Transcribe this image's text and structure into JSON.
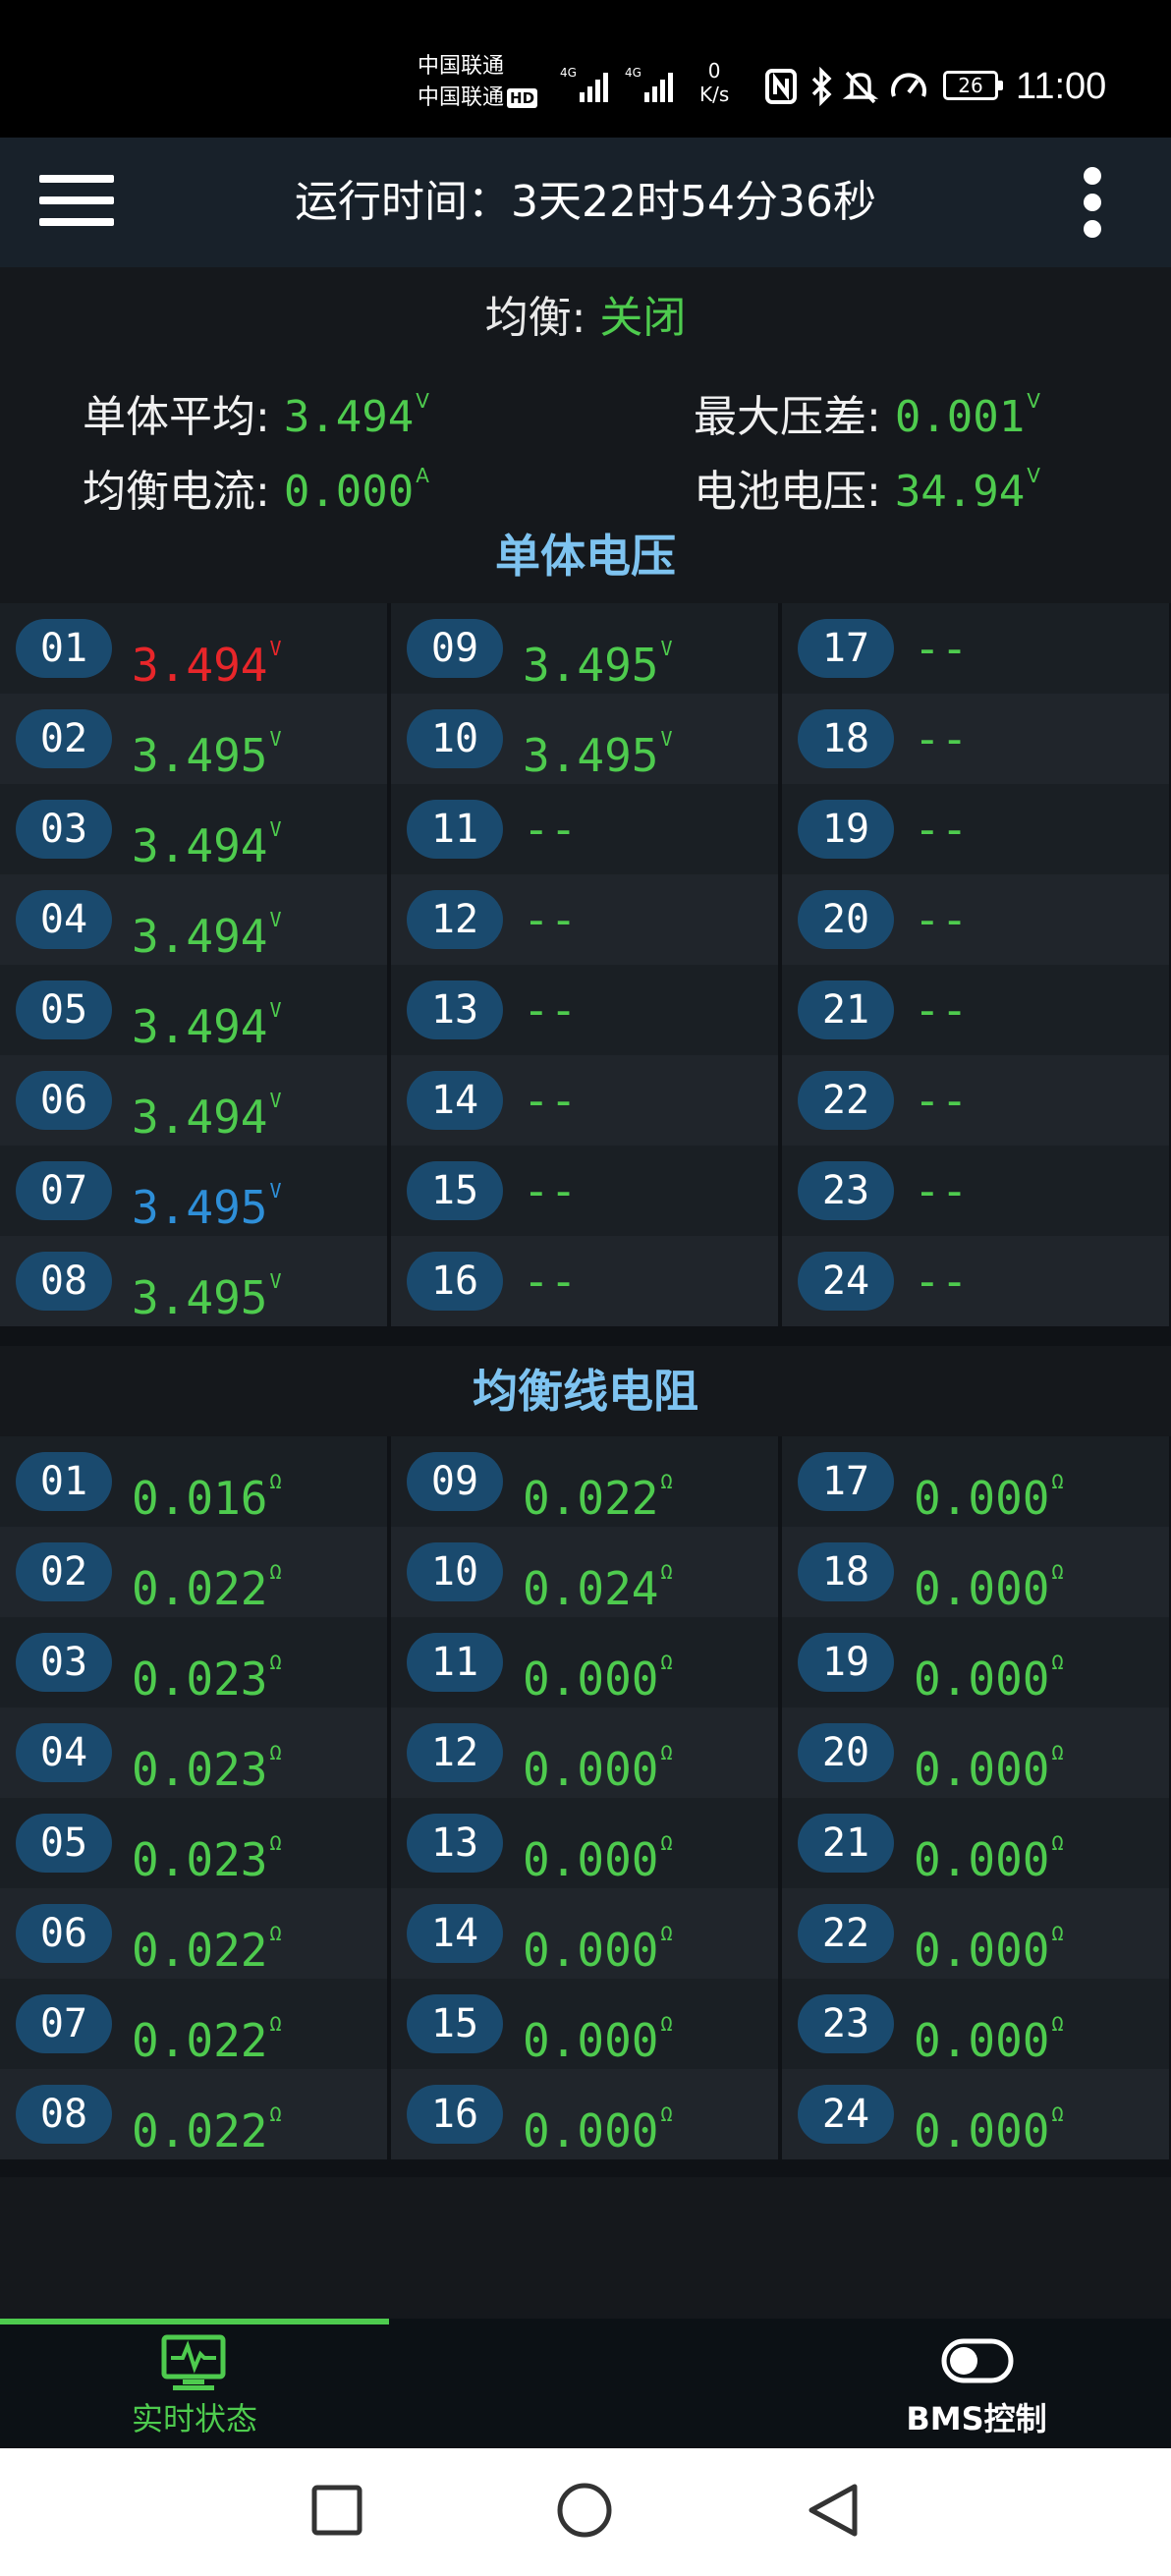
{
  "status_bar": {
    "carrier1": "中国联通",
    "carrier2": "中国联通",
    "hd_badge": "HD",
    "net1": "4G",
    "net2": "4G",
    "speed_value": "0",
    "speed_unit": "K/s",
    "battery": "26",
    "time": "11:00"
  },
  "header": {
    "title": "运行时间：3天22时54分36秒"
  },
  "summary": {
    "balance_label": "均衡: ",
    "balance_value": "关闭",
    "cell_avg_label": "单体平均: ",
    "cell_avg_value": "3.494",
    "cell_avg_unit": "V",
    "max_diff_label": "最大压差: ",
    "max_diff_value": "0.001",
    "max_diff_unit": "V",
    "balance_current_label": "均衡电流: ",
    "balance_current_value": "0.000",
    "balance_current_unit": "A",
    "battery_voltage_label": "电池电压: ",
    "battery_voltage_value": "34.94",
    "battery_voltage_unit": "V"
  },
  "cell_voltage": {
    "title": "单体电压",
    "unit": "V",
    "cells": [
      {
        "id": "01",
        "value": "3.494",
        "color": "#e8262a"
      },
      {
        "id": "02",
        "value": "3.495",
        "color": "#4ecb4e"
      },
      {
        "id": "03",
        "value": "3.494",
        "color": "#4ecb4e"
      },
      {
        "id": "04",
        "value": "3.494",
        "color": "#4ecb4e"
      },
      {
        "id": "05",
        "value": "3.494",
        "color": "#4ecb4e"
      },
      {
        "id": "06",
        "value": "3.494",
        "color": "#4ecb4e"
      },
      {
        "id": "07",
        "value": "3.495",
        "color": "#2e8fd8"
      },
      {
        "id": "08",
        "value": "3.495",
        "color": "#4ecb4e"
      },
      {
        "id": "09",
        "value": "3.495",
        "color": "#4ecb4e"
      },
      {
        "id": "10",
        "value": "3.495",
        "color": "#4ecb4e"
      },
      {
        "id": "11",
        "value": "--"
      },
      {
        "id": "12",
        "value": "--"
      },
      {
        "id": "13",
        "value": "--"
      },
      {
        "id": "14",
        "value": "--"
      },
      {
        "id": "15",
        "value": "--"
      },
      {
        "id": "16",
        "value": "--"
      },
      {
        "id": "17",
        "value": "--"
      },
      {
        "id": "18",
        "value": "--"
      },
      {
        "id": "19",
        "value": "--"
      },
      {
        "id": "20",
        "value": "--"
      },
      {
        "id": "21",
        "value": "--"
      },
      {
        "id": "22",
        "value": "--"
      },
      {
        "id": "23",
        "value": "--"
      },
      {
        "id": "24",
        "value": "--"
      }
    ]
  },
  "wire_resistance": {
    "title": "均衡线电阻",
    "unit": "Ω",
    "cells": [
      {
        "id": "01",
        "value": "0.016"
      },
      {
        "id": "02",
        "value": "0.022"
      },
      {
        "id": "03",
        "value": "0.023"
      },
      {
        "id": "04",
        "value": "0.023"
      },
      {
        "id": "05",
        "value": "0.023"
      },
      {
        "id": "06",
        "value": "0.022"
      },
      {
        "id": "07",
        "value": "0.022"
      },
      {
        "id": "08",
        "value": "0.022"
      },
      {
        "id": "09",
        "value": "0.022"
      },
      {
        "id": "10",
        "value": "0.024"
      },
      {
        "id": "11",
        "value": "0.000"
      },
      {
        "id": "12",
        "value": "0.000"
      },
      {
        "id": "13",
        "value": "0.000"
      },
      {
        "id": "14",
        "value": "0.000"
      },
      {
        "id": "15",
        "value": "0.000"
      },
      {
        "id": "16",
        "value": "0.000"
      },
      {
        "id": "17",
        "value": "0.000"
      },
      {
        "id": "18",
        "value": "0.000"
      },
      {
        "id": "19",
        "value": "0.000"
      },
      {
        "id": "20",
        "value": "0.000"
      },
      {
        "id": "21",
        "value": "0.000"
      },
      {
        "id": "22",
        "value": "0.000"
      },
      {
        "id": "23",
        "value": "0.000"
      },
      {
        "id": "24",
        "value": "0.000"
      }
    ]
  },
  "bottom_nav": {
    "items": [
      {
        "label": "实时状态",
        "icon": "monitor-icon",
        "active": true
      },
      {
        "label": "BMS控制",
        "icon": "toggle-icon",
        "active": false
      }
    ]
  },
  "colors": {
    "green": "#4ecb4e",
    "red": "#e8262a",
    "blue": "#2e8fd8",
    "section_title": "#7ec3f0",
    "badge": "#1a4a6e"
  }
}
